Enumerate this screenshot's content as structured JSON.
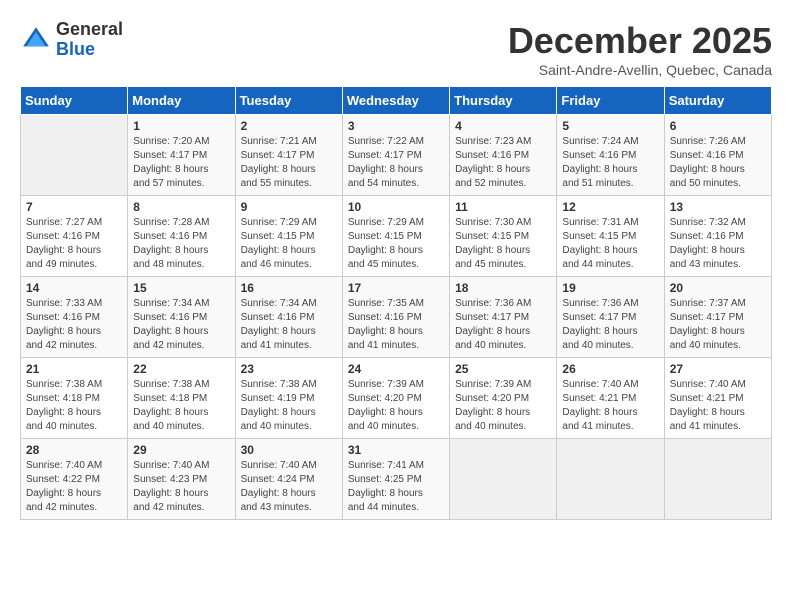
{
  "header": {
    "logo_general": "General",
    "logo_blue": "Blue",
    "title": "December 2025",
    "location": "Saint-Andre-Avellin, Quebec, Canada"
  },
  "weekdays": [
    "Sunday",
    "Monday",
    "Tuesday",
    "Wednesday",
    "Thursday",
    "Friday",
    "Saturday"
  ],
  "weeks": [
    [
      {
        "day": "",
        "info": ""
      },
      {
        "day": "1",
        "info": "Sunrise: 7:20 AM\nSunset: 4:17 PM\nDaylight: 8 hours\nand 57 minutes."
      },
      {
        "day": "2",
        "info": "Sunrise: 7:21 AM\nSunset: 4:17 PM\nDaylight: 8 hours\nand 55 minutes."
      },
      {
        "day": "3",
        "info": "Sunrise: 7:22 AM\nSunset: 4:17 PM\nDaylight: 8 hours\nand 54 minutes."
      },
      {
        "day": "4",
        "info": "Sunrise: 7:23 AM\nSunset: 4:16 PM\nDaylight: 8 hours\nand 52 minutes."
      },
      {
        "day": "5",
        "info": "Sunrise: 7:24 AM\nSunset: 4:16 PM\nDaylight: 8 hours\nand 51 minutes."
      },
      {
        "day": "6",
        "info": "Sunrise: 7:26 AM\nSunset: 4:16 PM\nDaylight: 8 hours\nand 50 minutes."
      }
    ],
    [
      {
        "day": "7",
        "info": "Sunrise: 7:27 AM\nSunset: 4:16 PM\nDaylight: 8 hours\nand 49 minutes."
      },
      {
        "day": "8",
        "info": "Sunrise: 7:28 AM\nSunset: 4:16 PM\nDaylight: 8 hours\nand 48 minutes."
      },
      {
        "day": "9",
        "info": "Sunrise: 7:29 AM\nSunset: 4:15 PM\nDaylight: 8 hours\nand 46 minutes."
      },
      {
        "day": "10",
        "info": "Sunrise: 7:29 AM\nSunset: 4:15 PM\nDaylight: 8 hours\nand 45 minutes."
      },
      {
        "day": "11",
        "info": "Sunrise: 7:30 AM\nSunset: 4:15 PM\nDaylight: 8 hours\nand 45 minutes."
      },
      {
        "day": "12",
        "info": "Sunrise: 7:31 AM\nSunset: 4:15 PM\nDaylight: 8 hours\nand 44 minutes."
      },
      {
        "day": "13",
        "info": "Sunrise: 7:32 AM\nSunset: 4:16 PM\nDaylight: 8 hours\nand 43 minutes."
      }
    ],
    [
      {
        "day": "14",
        "info": "Sunrise: 7:33 AM\nSunset: 4:16 PM\nDaylight: 8 hours\nand 42 minutes."
      },
      {
        "day": "15",
        "info": "Sunrise: 7:34 AM\nSunset: 4:16 PM\nDaylight: 8 hours\nand 42 minutes."
      },
      {
        "day": "16",
        "info": "Sunrise: 7:34 AM\nSunset: 4:16 PM\nDaylight: 8 hours\nand 41 minutes."
      },
      {
        "day": "17",
        "info": "Sunrise: 7:35 AM\nSunset: 4:16 PM\nDaylight: 8 hours\nand 41 minutes."
      },
      {
        "day": "18",
        "info": "Sunrise: 7:36 AM\nSunset: 4:17 PM\nDaylight: 8 hours\nand 40 minutes."
      },
      {
        "day": "19",
        "info": "Sunrise: 7:36 AM\nSunset: 4:17 PM\nDaylight: 8 hours\nand 40 minutes."
      },
      {
        "day": "20",
        "info": "Sunrise: 7:37 AM\nSunset: 4:17 PM\nDaylight: 8 hours\nand 40 minutes."
      }
    ],
    [
      {
        "day": "21",
        "info": "Sunrise: 7:38 AM\nSunset: 4:18 PM\nDaylight: 8 hours\nand 40 minutes."
      },
      {
        "day": "22",
        "info": "Sunrise: 7:38 AM\nSunset: 4:18 PM\nDaylight: 8 hours\nand 40 minutes."
      },
      {
        "day": "23",
        "info": "Sunrise: 7:38 AM\nSunset: 4:19 PM\nDaylight: 8 hours\nand 40 minutes."
      },
      {
        "day": "24",
        "info": "Sunrise: 7:39 AM\nSunset: 4:20 PM\nDaylight: 8 hours\nand 40 minutes."
      },
      {
        "day": "25",
        "info": "Sunrise: 7:39 AM\nSunset: 4:20 PM\nDaylight: 8 hours\nand 40 minutes."
      },
      {
        "day": "26",
        "info": "Sunrise: 7:40 AM\nSunset: 4:21 PM\nDaylight: 8 hours\nand 41 minutes."
      },
      {
        "day": "27",
        "info": "Sunrise: 7:40 AM\nSunset: 4:21 PM\nDaylight: 8 hours\nand 41 minutes."
      }
    ],
    [
      {
        "day": "28",
        "info": "Sunrise: 7:40 AM\nSunset: 4:22 PM\nDaylight: 8 hours\nand 42 minutes."
      },
      {
        "day": "29",
        "info": "Sunrise: 7:40 AM\nSunset: 4:23 PM\nDaylight: 8 hours\nand 42 minutes."
      },
      {
        "day": "30",
        "info": "Sunrise: 7:40 AM\nSunset: 4:24 PM\nDaylight: 8 hours\nand 43 minutes."
      },
      {
        "day": "31",
        "info": "Sunrise: 7:41 AM\nSunset: 4:25 PM\nDaylight: 8 hours\nand 44 minutes."
      },
      {
        "day": "",
        "info": ""
      },
      {
        "day": "",
        "info": ""
      },
      {
        "day": "",
        "info": ""
      }
    ]
  ]
}
